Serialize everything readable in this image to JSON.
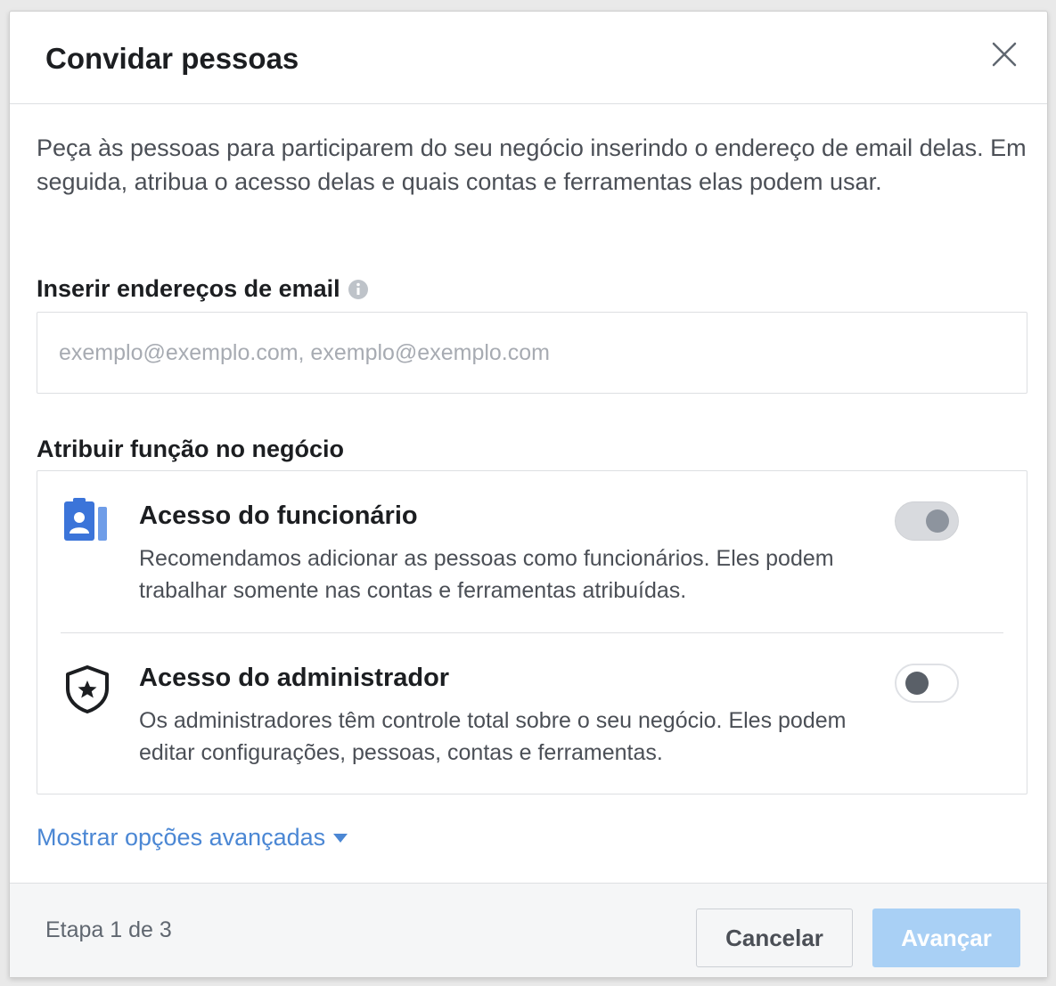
{
  "dialog": {
    "title": "Convidar pessoas",
    "close_icon": "close-icon"
  },
  "intro": {
    "text": "Peça às pessoas para participarem do seu negócio inserindo o endereço de email delas. Em seguida, atribua o acesso delas e quais contas e ferramentas elas podem usar."
  },
  "email_section": {
    "label": "Inserir endereços de email",
    "info_icon": "info-icon",
    "placeholder": "exemplo@exemplo.com, exemplo@exemplo.com",
    "value": ""
  },
  "role_section": {
    "label": "Atribuir função no negócio",
    "roles": [
      {
        "icon": "employee-badge-icon",
        "title": "Acesso do funcionário",
        "description": "Recomendamos adicionar as pessoas como funcionários. Eles podem trabalhar somente nas contas e ferramentas atribuídas.",
        "toggle_state": "on"
      },
      {
        "icon": "admin-shield-icon",
        "title": "Acesso do administrador",
        "description": "Os administradores têm controle total sobre o seu negócio. Eles podem editar configurações, pessoas, contas e ferramentas.",
        "toggle_state": "off"
      }
    ]
  },
  "advanced": {
    "label": "Mostrar opções avançadas",
    "caret_icon": "caret-down-icon"
  },
  "footer": {
    "step": "Etapa 1 de 3",
    "cancel_label": "Cancelar",
    "next_label": "Avançar"
  },
  "colors": {
    "link": "#4b87d4",
    "primary_disabled": "#a9d0f5",
    "employee_icon": "#3b74d9"
  }
}
